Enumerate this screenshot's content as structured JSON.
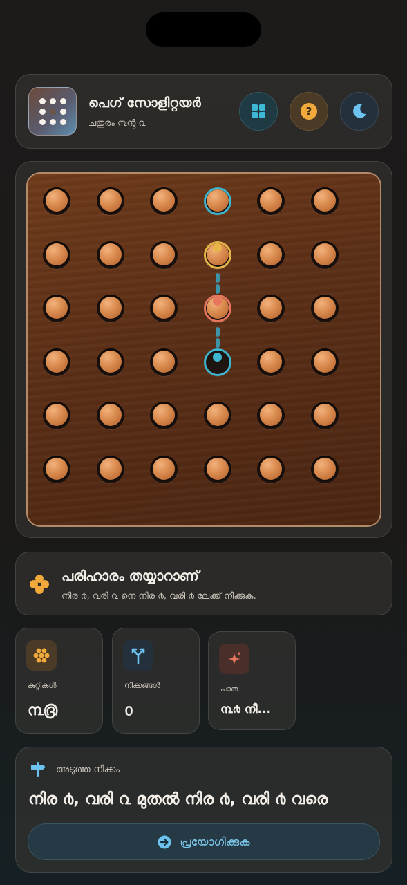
{
  "header": {
    "title": "പെഗ് സോളിറ്റയർ",
    "subtitle": "ചതുരം ൩ന്റ ൨",
    "buttons": [
      {
        "name": "grid-button",
        "icon": "grid-icon",
        "color": "#3fb8d6"
      },
      {
        "name": "help-button",
        "icon": "help-icon",
        "color": "#f0a93a"
      },
      {
        "name": "theme-button",
        "icon": "moon-icon",
        "color": "#6cc3ef"
      }
    ]
  },
  "board": {
    "rows": 6,
    "cols": 6,
    "all_holes_filled": true,
    "highlights": [
      {
        "row": 1,
        "col": 4,
        "ring": "#3fb6cf"
      },
      {
        "row": 2,
        "col": 4,
        "ring": "#e7b548",
        "badge": "#e7b548"
      },
      {
        "row": 3,
        "col": 4,
        "ring": "#e8765e",
        "badge": "#e8765e"
      },
      {
        "row": 4,
        "col": 4,
        "ring": "#3fb6cf",
        "empty": true,
        "badge": "#3fb6cf"
      }
    ]
  },
  "status": {
    "icon": "solution-icon",
    "title": "പരിഹാരം തയ്യാറാണ്",
    "text": "നിര ൪, വരി ൨ നെ നിര ൪, വരി ൪ ലേക്ക് നീക്കുക."
  },
  "stats": [
    {
      "icon": "pegs-icon",
      "label": "കുറ്റികൾ",
      "value": "൩൫",
      "accent": "#f0a93a"
    },
    {
      "icon": "moves-icon",
      "label": "നീക്കങ്ങൾ",
      "value": "൦",
      "accent": "#6cc3ef"
    },
    {
      "icon": "sparkle-icon",
      "label": "പാത",
      "value": "൩൪ നീ...",
      "accent": "#e8765e"
    }
  ],
  "next_move": {
    "icon": "signpost-icon",
    "label": "അടുത്ത നീക്കം",
    "move": "നിര ൪, വരി ൨ മുതൽ നിര ൪, വരി ൪ വരെ",
    "apply_label": "പ്രയോഗിക്കുക"
  }
}
